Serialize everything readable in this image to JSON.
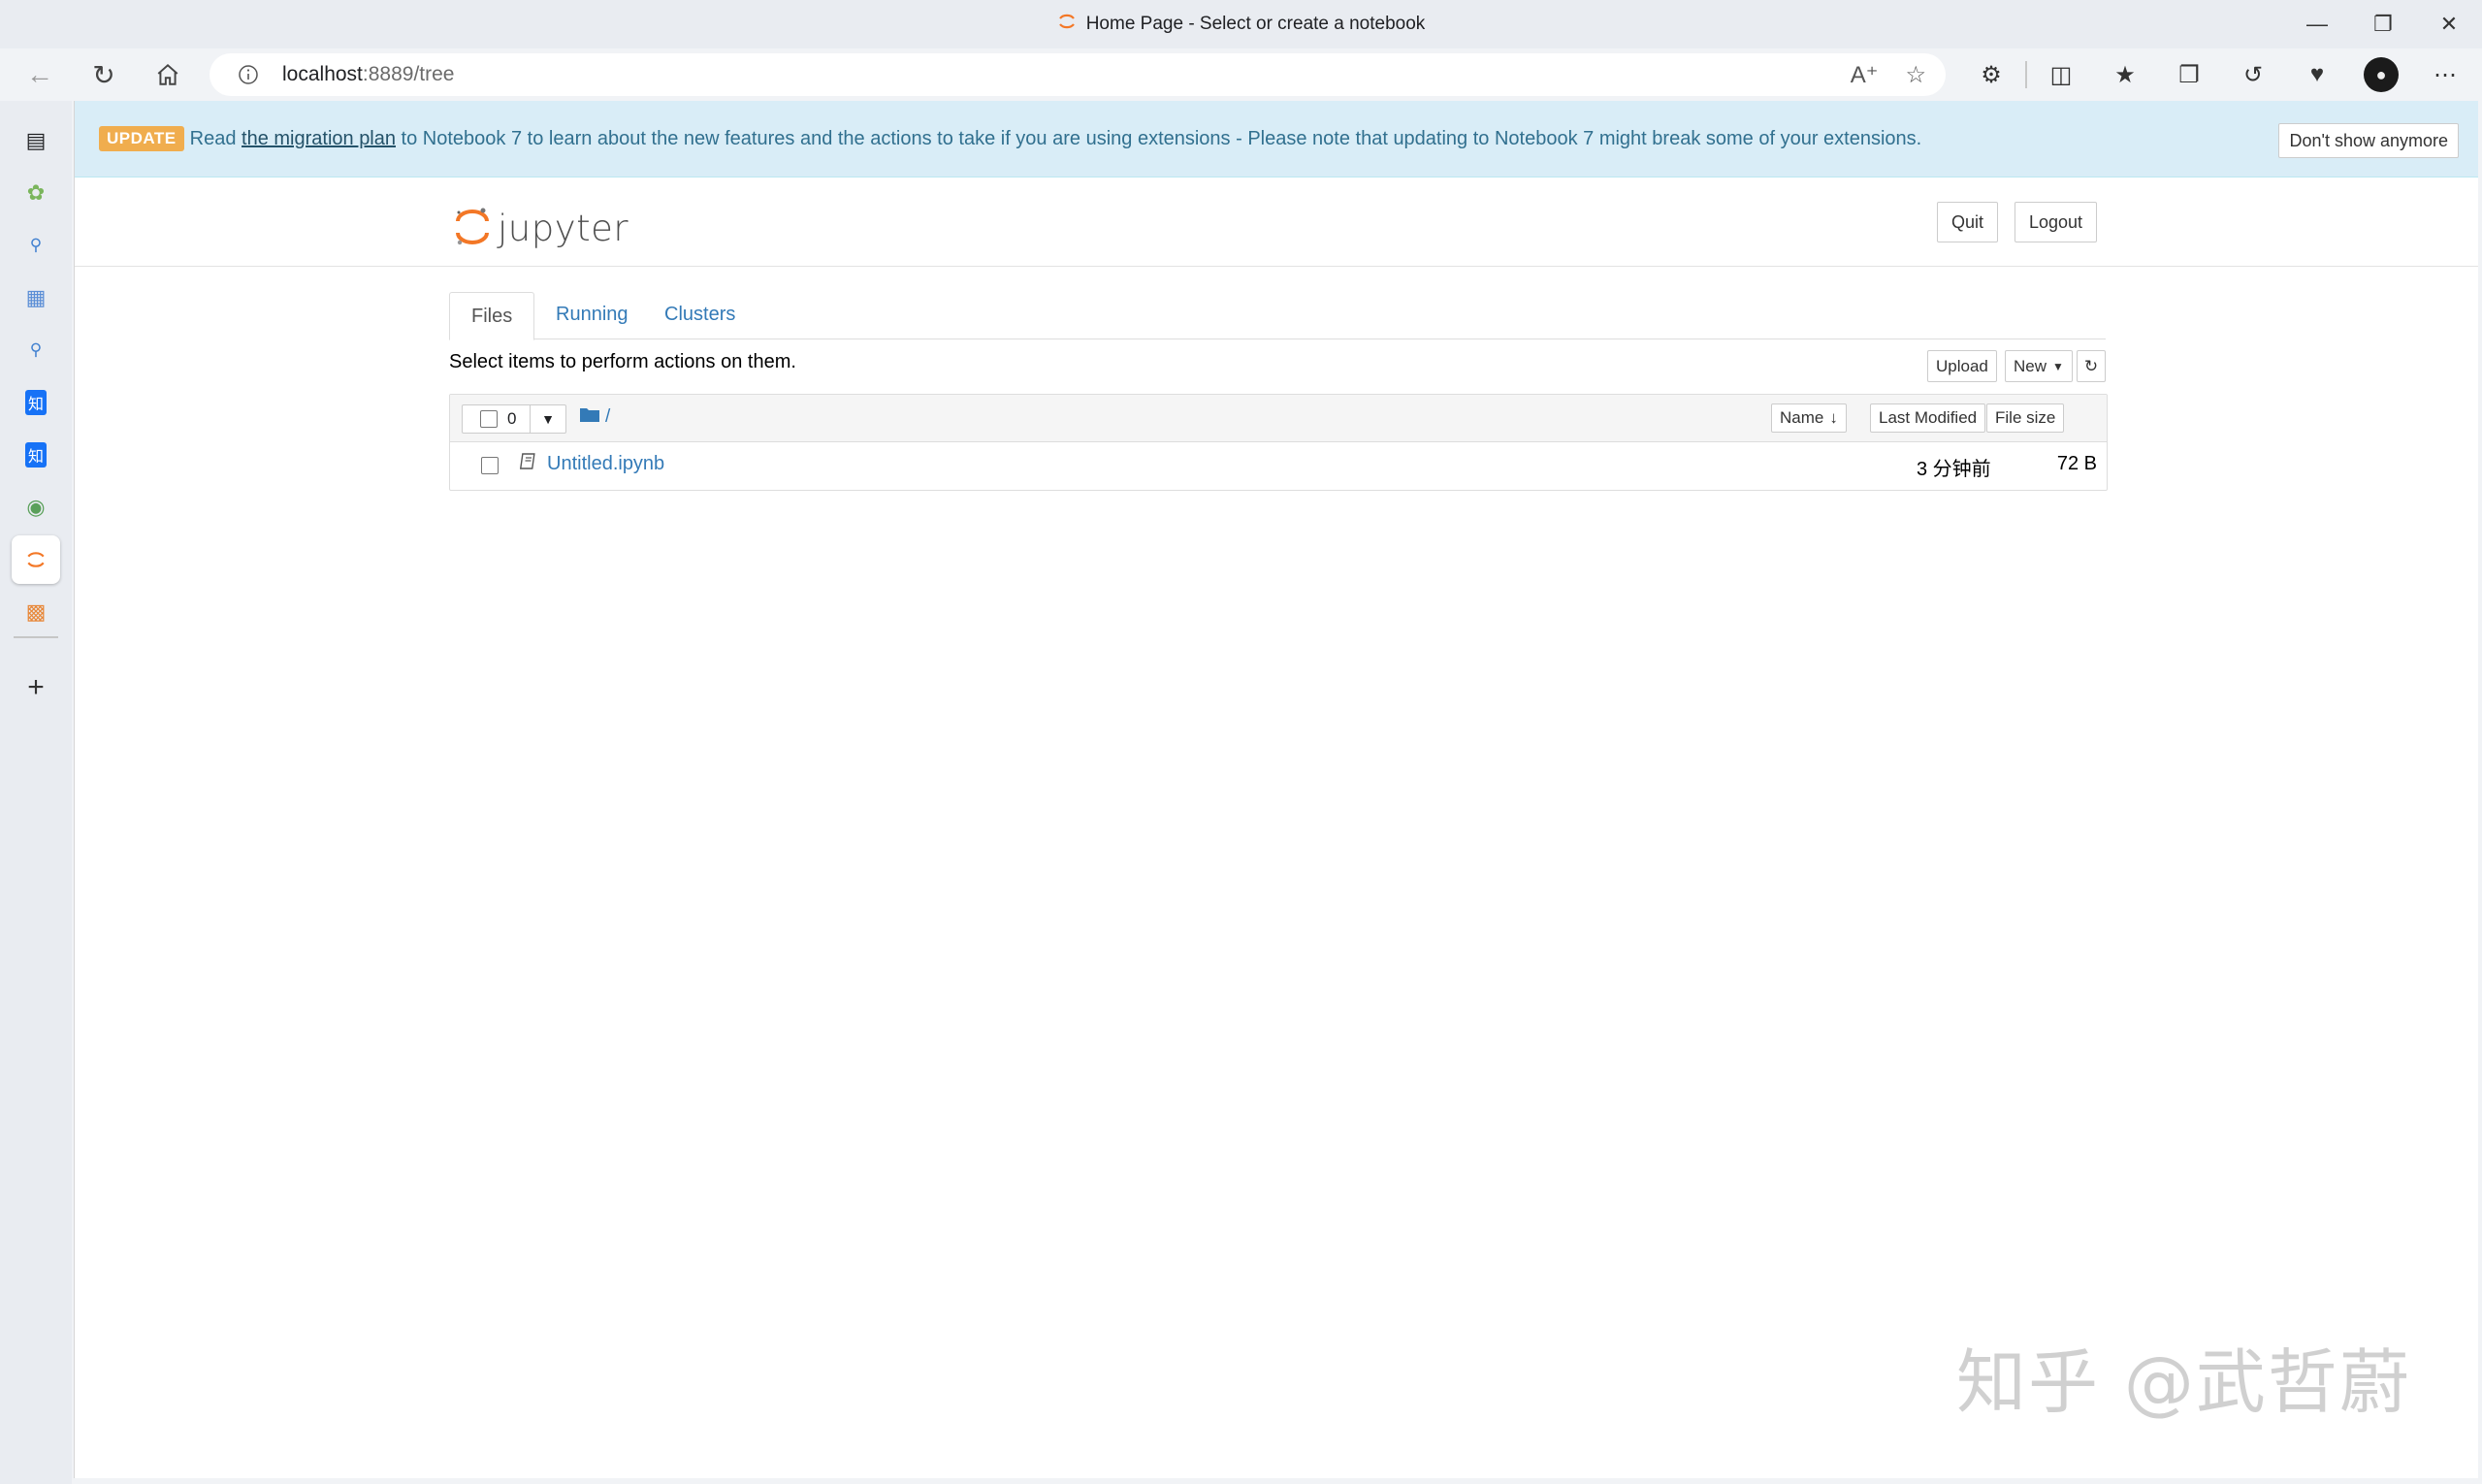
{
  "browser": {
    "tab_title": "Home Page - Select or create a notebook",
    "url_host": "localhost",
    "url_rest": ":8889/tree",
    "window_controls": [
      "minimize-icon",
      "restore-icon",
      "close-icon"
    ]
  },
  "banner": {
    "badge": "UPDATE",
    "text_before": "Read ",
    "link": "the migration plan",
    "text_after": " to Notebook 7 to learn about the new features and the actions to take if you are using extensions - Please note that updating to Notebook 7 might break some of your extensions.",
    "dismiss_button": "Don't show anymore"
  },
  "header": {
    "logo_text": "jupyter",
    "quit_button": "Quit",
    "logout_button": "Logout"
  },
  "tabs": [
    {
      "label": "Files",
      "active": true
    },
    {
      "label": "Running",
      "active": false
    },
    {
      "label": "Clusters",
      "active": false
    }
  ],
  "toolbar": {
    "select_message": "Select items to perform actions on them.",
    "upload_button": "Upload",
    "new_button": "New"
  },
  "file_list": {
    "selected_count": "0",
    "breadcrumb": "/",
    "columns": {
      "name": "Name",
      "last_modified": "Last Modified",
      "file_size": "File size"
    },
    "rows": [
      {
        "name": "Untitled.ipynb",
        "modified": "3 分钟前",
        "size": "72 B"
      }
    ]
  },
  "watermark": "知乎 @武哲蔚",
  "colors": {
    "link": "#337ab7",
    "banner_bg": "#d9edf7",
    "update_badge": "#f0ad4e",
    "jupyter_orange": "#f37726"
  }
}
